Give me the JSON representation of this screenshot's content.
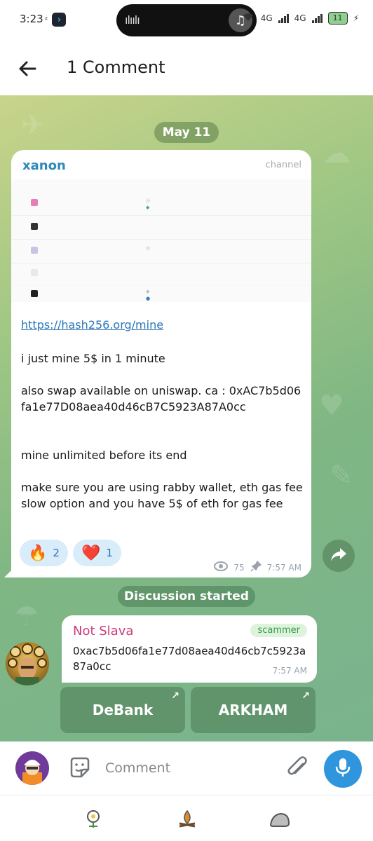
{
  "status_bar": {
    "time": "3:23",
    "network_1": "4G",
    "network_2": "4G",
    "battery": "11"
  },
  "header": {
    "title": "1 Comment"
  },
  "chat": {
    "date": "May 11",
    "post": {
      "author": "xanon",
      "badge": "channel",
      "link": "https://hash256.org/mine",
      "body": "i just mine 5$ in 1 minute\n\nalso swap available on uniswap. ca : 0xAC7b5d06fa1e77D08aea40d46cB7C5923A87A0cc\n\n\nmine unlimited before its end\n\nmake sure you are using rabby wallet, eth gas fee slow option and you have 5$ of eth for gas fee",
      "reactions": [
        {
          "emoji": "🔥",
          "count": "2"
        },
        {
          "emoji": "❤️",
          "count": "1"
        }
      ],
      "views": "75",
      "time": "7:57 AM"
    },
    "discussion_label": "Discussion started",
    "comment": {
      "author": "Not Slava",
      "badge": "scammer",
      "text": "0xac7b5d06fa1e77d08aea40d46cb7c5923a87a0cc",
      "time": "7:57 AM"
    },
    "buttons": {
      "debank": "DeBank",
      "arkham": "ARKHAM"
    }
  },
  "input": {
    "placeholder": "Comment"
  },
  "colors": {
    "accent": "#2f95dc",
    "author_channel": "#2b8ab8",
    "author_comment": "#cc3c78",
    "badge_scammer": "#3a9a4d"
  },
  "icons": {
    "back": "arrow-left-icon",
    "sticker": "sticker-icon",
    "attach": "paperclip-icon",
    "mic": "microphone-icon",
    "share": "share-arrow-icon",
    "views": "eye-icon",
    "pin": "pin-icon"
  }
}
